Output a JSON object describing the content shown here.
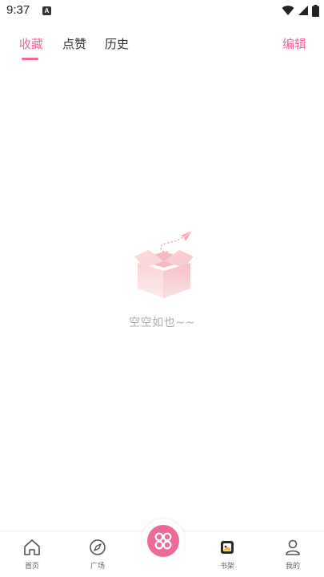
{
  "status_bar": {
    "time": "9:37",
    "notif_glyph": "A"
  },
  "tabs": [
    {
      "label": "收藏"
    },
    {
      "label": "点赞"
    },
    {
      "label": "历史"
    }
  ],
  "edit_label": "编辑",
  "empty_state": {
    "text": "空空如也~~"
  },
  "bottom_nav": [
    {
      "label": "首页",
      "icon": "home-icon"
    },
    {
      "label": "广场",
      "icon": "compass-icon"
    },
    {
      "label": "",
      "icon": "clover-icon"
    },
    {
      "label": "书架",
      "icon": "bookshelf-icon"
    },
    {
      "label": "我的",
      "icon": "user-icon"
    }
  ],
  "colors": {
    "accent": "#ee6a94",
    "empty_text": "#a8afb8"
  }
}
